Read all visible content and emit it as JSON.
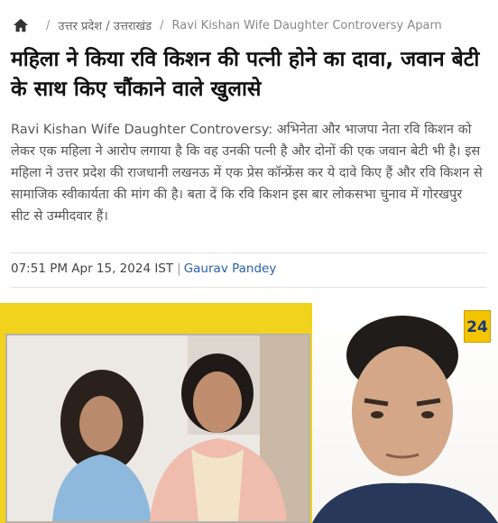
{
  "breadcrumb": {
    "home_icon": "home-icon",
    "items": [
      "उत्तर प्रदेश / उत्तराखंड",
      "Ravi Kishan Wife Daughter Controversy Aparn"
    ]
  },
  "headline": "महिला ने किया रवि किशन की पत्नी होने का दावा, जवान बेटी के साथ किए चौंकाने वाले खुलासे",
  "summary": "Ravi Kishan Wife Daughter Controversy: अभिनेता और भाजपा नेता रवि किशन को लेकर एक महिला ने आरोप लगाया है कि वह उनकी पत्नी है और दोनों की एक जवान बेटी भी है। इस महिला ने उत्तर प्रदेश की राजधानी लखनऊ में एक प्रेस कॉन्फ्रेंस कर ये दावे किए हैं और रवि किशन से सामाजिक स्वीकार्यता की मांग की है। बता दें कि रवि किशन इस बार लोकसभा चुनाव में गोरखपुर सीट से उम्मीदवार हैं।",
  "meta": {
    "timestamp": "07:51 PM Apr 15, 2024 IST",
    "separator": "|",
    "author": "Gaurav Pandey"
  },
  "hero": {
    "logo_text": "24",
    "colors": {
      "background": "#f1d21d",
      "accent_link": "#2a5fa8"
    }
  }
}
